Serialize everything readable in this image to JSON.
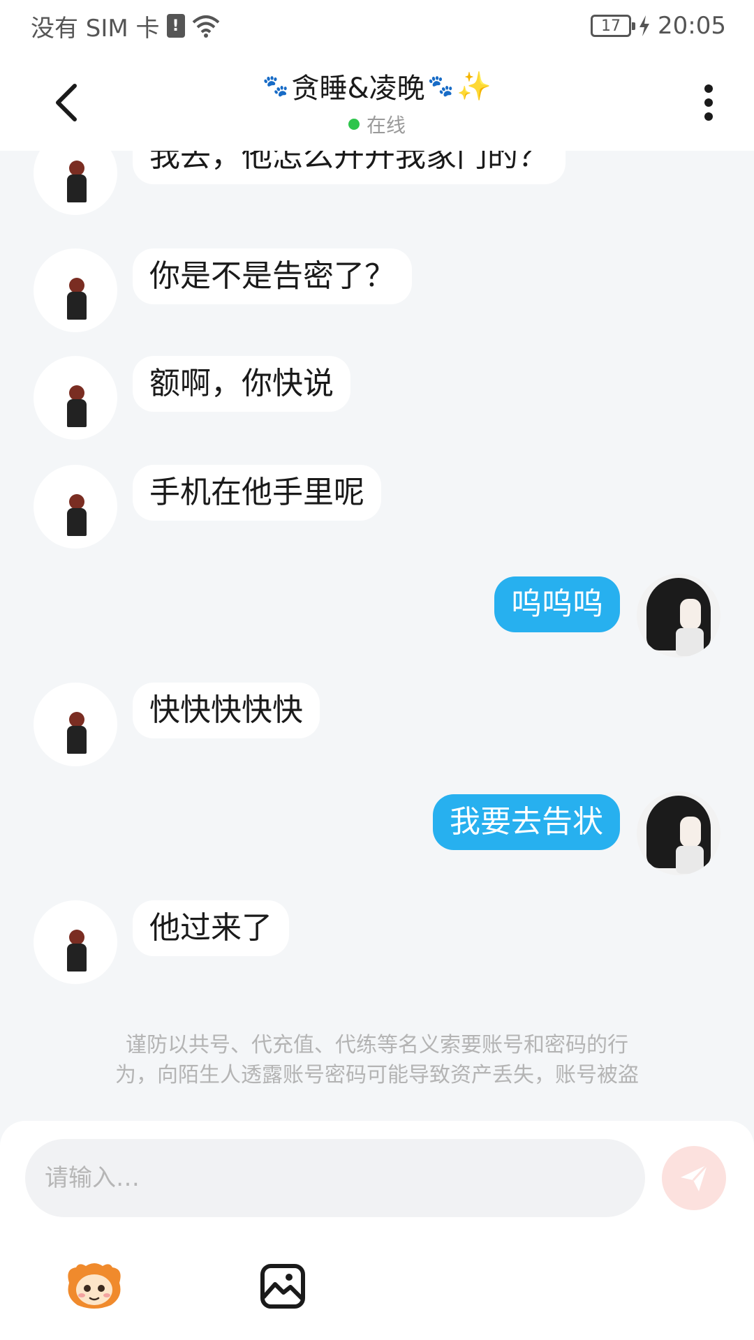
{
  "status_bar": {
    "carrier": "没有 SIM 卡",
    "sim_alert": "!",
    "battery": "17",
    "time": "20:05"
  },
  "header": {
    "title": "贪睡&凌晚",
    "status": "在线",
    "status_color": "#2ec54c"
  },
  "messages": [
    {
      "side": "left",
      "text": "我去，他怎么开开我家门的？"
    },
    {
      "side": "left",
      "text": "你是不是告密了？"
    },
    {
      "side": "left",
      "text": "额啊，你快说"
    },
    {
      "side": "left",
      "text": "手机在他手里呢"
    },
    {
      "side": "right",
      "text": "呜呜呜"
    },
    {
      "side": "left",
      "text": "快快快快快"
    },
    {
      "side": "right",
      "text": "我要去告状"
    },
    {
      "side": "left",
      "text": "他过来了"
    }
  ],
  "notice": {
    "line1": "谨防以共号、代充值、代练等名义索要账号和密码的行",
    "line2": "为，向陌生人透露账号密码可能导致资产丢失，账号被盗"
  },
  "composer": {
    "placeholder": "请输入…"
  },
  "icons": {
    "back": "back-arrow-icon",
    "more": "more-vertical-icon",
    "send": "send-icon",
    "emoji": "mascot-emoji-icon",
    "image": "image-icon"
  },
  "colors": {
    "accent": "#27b0ef",
    "send_disabled": "#fce1de",
    "background": "#f4f6f8"
  }
}
